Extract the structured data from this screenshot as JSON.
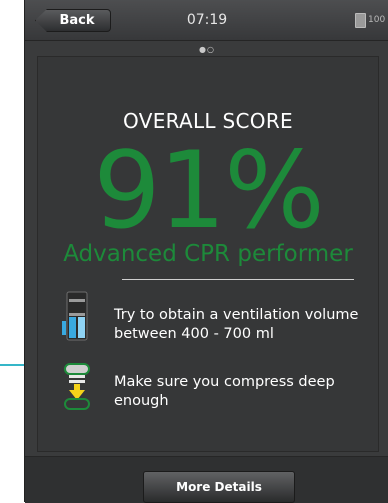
{
  "topbar": {
    "back_label": "Back",
    "time": "07:19",
    "battery_label": "100"
  },
  "pager": {
    "indicator": "●○",
    "current_page": 1,
    "total_pages": 2
  },
  "result": {
    "title": "OVERALL SCORE",
    "score": "91%",
    "level": "Advanced CPR performer"
  },
  "tips": [
    {
      "icon": "ventilation-volume-icon",
      "text": "Try to obtain a ventilation volume between 400 - 700 ml"
    },
    {
      "icon": "compression-depth-icon",
      "text": "Make sure you compress deep enough"
    }
  ],
  "footer": {
    "more_label": "More Details"
  },
  "colors": {
    "accent_green": "#1d8a3a",
    "annotation_blue": "#35b6c8",
    "panel_bg": "#363738"
  }
}
